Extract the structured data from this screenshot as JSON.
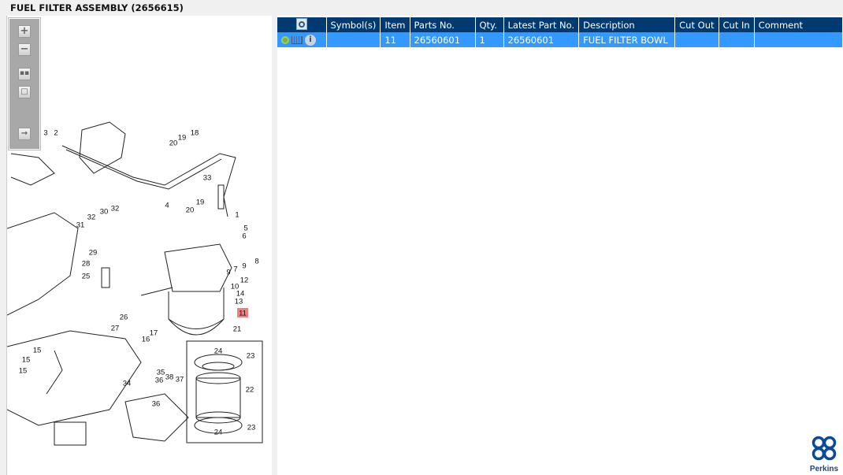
{
  "title": "FUEL FILTER ASSEMBLY (2656615)",
  "toolbar": {
    "zoom_in": "+",
    "zoom_out": "−"
  },
  "table": {
    "headers": [
      "",
      "Symbol(s)",
      "Item",
      "Parts No.",
      "Qty.",
      "Latest Part No.",
      "Description",
      "Cut Out",
      "Cut In",
      "Comment"
    ],
    "rows": [
      {
        "symbols": "",
        "item": "11",
        "parts_no": "26560601",
        "qty": "1",
        "latest_part_no": "26560601",
        "description": "FUEL FILTER BOWL",
        "cut_out": "",
        "cut_in": "",
        "comment": ""
      }
    ]
  },
  "diagram": {
    "callouts": [
      "3",
      "2",
      "20",
      "19",
      "18",
      "33",
      "4",
      "19",
      "20",
      "1",
      "5",
      "6",
      "8",
      "9",
      "7",
      "9",
      "12",
      "10",
      "14",
      "13",
      "11",
      "21",
      "23",
      "24",
      "22",
      "24",
      "23",
      "32",
      "30",
      "32",
      "31",
      "29",
      "28",
      "25",
      "26",
      "27",
      "16",
      "17",
      "15",
      "15",
      "15",
      "35",
      "36",
      "38",
      "37",
      "34",
      "36"
    ],
    "highlighted": "11"
  },
  "logo": {
    "text": "Perkins"
  },
  "colors": {
    "header": "#003a70",
    "selected_row": "#3399ff",
    "highlight": "#f08080"
  }
}
